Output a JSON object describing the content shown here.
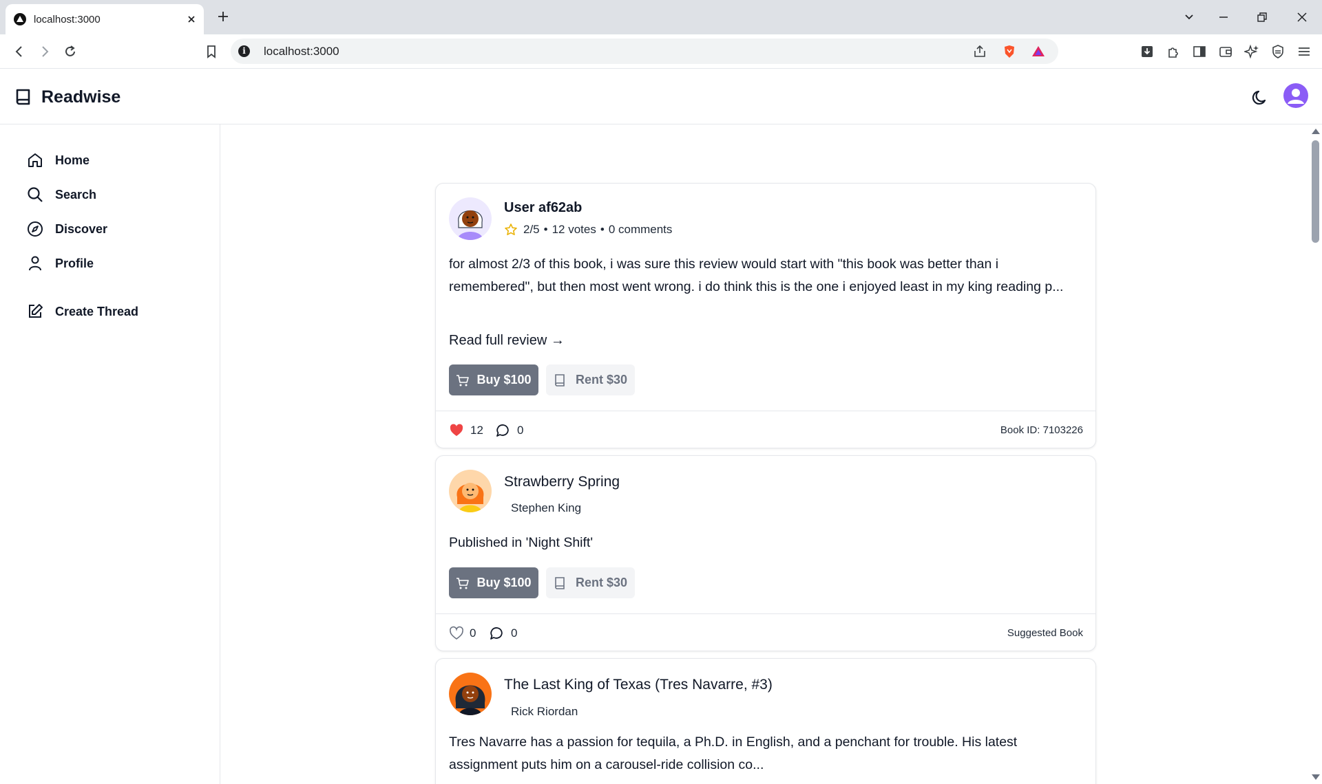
{
  "browser": {
    "tab_title": "localhost:3000",
    "url": "localhost:3000"
  },
  "app": {
    "name": "Readwise",
    "accent": "#8b5cf6"
  },
  "sidebar": {
    "items": [
      {
        "label": "Home",
        "icon": "home-icon"
      },
      {
        "label": "Search",
        "icon": "search-icon"
      },
      {
        "label": "Discover",
        "icon": "compass-icon"
      },
      {
        "label": "Profile",
        "icon": "user-icon"
      },
      {
        "label": "Create Thread",
        "icon": "edit-icon"
      }
    ]
  },
  "feed": [
    {
      "title": "User af62ab",
      "rating": "2/5",
      "votes": "12 votes",
      "comments": "0 comments",
      "meta_sep": "•",
      "body": "for almost 2/3 of this book, i was sure this review would start with \"this book was better than i remembered\", but then most went wrong. i do think this is the one i enjoyed least in my king reading p...",
      "read_more": "Read full review →",
      "buy_label": "Buy $100",
      "rent_label": "Rent $30",
      "likes": "12",
      "liked": true,
      "comment_count": "0",
      "footer_right": "Book ID: 7103226"
    },
    {
      "title": "Strawberry Spring",
      "author": "Stephen King",
      "body": "Published in 'Night Shift'",
      "buy_label": "Buy $100",
      "rent_label": "Rent $30",
      "likes": "0",
      "liked": false,
      "comment_count": "0",
      "footer_right": "Suggested Book"
    },
    {
      "title": "The Last King of Texas (Tres Navarre, #3)",
      "author": "Rick Riordan",
      "body": "Tres Navarre has a passion for tequila, a Ph.D. in English, and a penchant for trouble. His latest assignment puts him on a carousel-ride collision co..."
    }
  ],
  "colors": {
    "buy_button": "#6b7280",
    "rent_button": "#f3f4f6",
    "like_active": "#ef4444",
    "star": "#eab308"
  }
}
